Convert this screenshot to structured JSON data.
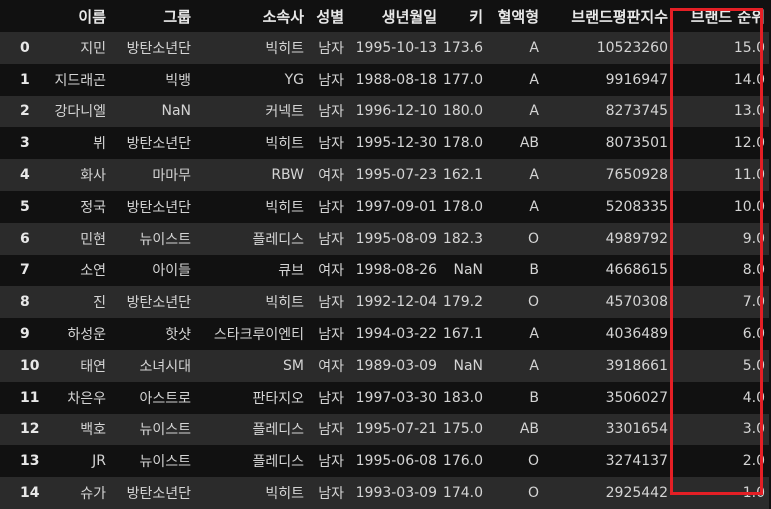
{
  "columns": [
    "",
    "이름",
    "그룹",
    "소속사",
    "성별",
    "생년월일",
    "키",
    "혈액형",
    "브랜드평판지수",
    "브랜드 순위"
  ],
  "rows": [
    {
      "idx": "0",
      "name": "지민",
      "group": "방탄소년단",
      "agency": "빅히트",
      "gender": "남자",
      "birth": "1995-10-13",
      "height": "173.6",
      "blood": "A",
      "brand": "10523260",
      "rank": "15.0"
    },
    {
      "idx": "1",
      "name": "지드래곤",
      "group": "빅뱅",
      "agency": "YG",
      "gender": "남자",
      "birth": "1988-08-18",
      "height": "177.0",
      "blood": "A",
      "brand": "9916947",
      "rank": "14.0"
    },
    {
      "idx": "2",
      "name": "강다니엘",
      "group": "NaN",
      "agency": "커넥트",
      "gender": "남자",
      "birth": "1996-12-10",
      "height": "180.0",
      "blood": "A",
      "brand": "8273745",
      "rank": "13.0"
    },
    {
      "idx": "3",
      "name": "뷔",
      "group": "방탄소년단",
      "agency": "빅히트",
      "gender": "남자",
      "birth": "1995-12-30",
      "height": "178.0",
      "blood": "AB",
      "brand": "8073501",
      "rank": "12.0"
    },
    {
      "idx": "4",
      "name": "화사",
      "group": "마마무",
      "agency": "RBW",
      "gender": "여자",
      "birth": "1995-07-23",
      "height": "162.1",
      "blood": "A",
      "brand": "7650928",
      "rank": "11.0"
    },
    {
      "idx": "5",
      "name": "정국",
      "group": "방탄소년단",
      "agency": "빅히트",
      "gender": "남자",
      "birth": "1997-09-01",
      "height": "178.0",
      "blood": "A",
      "brand": "5208335",
      "rank": "10.0"
    },
    {
      "idx": "6",
      "name": "민현",
      "group": "뉴이스트",
      "agency": "플레디스",
      "gender": "남자",
      "birth": "1995-08-09",
      "height": "182.3",
      "blood": "O",
      "brand": "4989792",
      "rank": "9.0"
    },
    {
      "idx": "7",
      "name": "소연",
      "group": "아이들",
      "agency": "큐브",
      "gender": "여자",
      "birth": "1998-08-26",
      "height": "NaN",
      "blood": "B",
      "brand": "4668615",
      "rank": "8.0"
    },
    {
      "idx": "8",
      "name": "진",
      "group": "방탄소년단",
      "agency": "빅히트",
      "gender": "남자",
      "birth": "1992-12-04",
      "height": "179.2",
      "blood": "O",
      "brand": "4570308",
      "rank": "7.0"
    },
    {
      "idx": "9",
      "name": "하성운",
      "group": "핫샷",
      "agency": "스타크루이엔티",
      "gender": "남자",
      "birth": "1994-03-22",
      "height": "167.1",
      "blood": "A",
      "brand": "4036489",
      "rank": "6.0"
    },
    {
      "idx": "10",
      "name": "태연",
      "group": "소녀시대",
      "agency": "SM",
      "gender": "여자",
      "birth": "1989-03-09",
      "height": "NaN",
      "blood": "A",
      "brand": "3918661",
      "rank": "5.0"
    },
    {
      "idx": "11",
      "name": "차은우",
      "group": "아스트로",
      "agency": "판타지오",
      "gender": "남자",
      "birth": "1997-03-30",
      "height": "183.0",
      "blood": "B",
      "brand": "3506027",
      "rank": "4.0"
    },
    {
      "idx": "12",
      "name": "백호",
      "group": "뉴이스트",
      "agency": "플레디스",
      "gender": "남자",
      "birth": "1995-07-21",
      "height": "175.0",
      "blood": "AB",
      "brand": "3301654",
      "rank": "3.0"
    },
    {
      "idx": "13",
      "name": "JR",
      "group": "뉴이스트",
      "agency": "플레디스",
      "gender": "남자",
      "birth": "1995-06-08",
      "height": "176.0",
      "blood": "O",
      "brand": "3274137",
      "rank": "2.0"
    },
    {
      "idx": "14",
      "name": "슈가",
      "group": "방탄소년단",
      "agency": "빅히트",
      "gender": "남자",
      "birth": "1993-03-09",
      "height": "174.0",
      "blood": "O",
      "brand": "2925442",
      "rank": "1.0"
    }
  ],
  "colors": {
    "background": "#111111",
    "row_alt": "#2b2b2b",
    "highlight_border": "#e41f25"
  }
}
